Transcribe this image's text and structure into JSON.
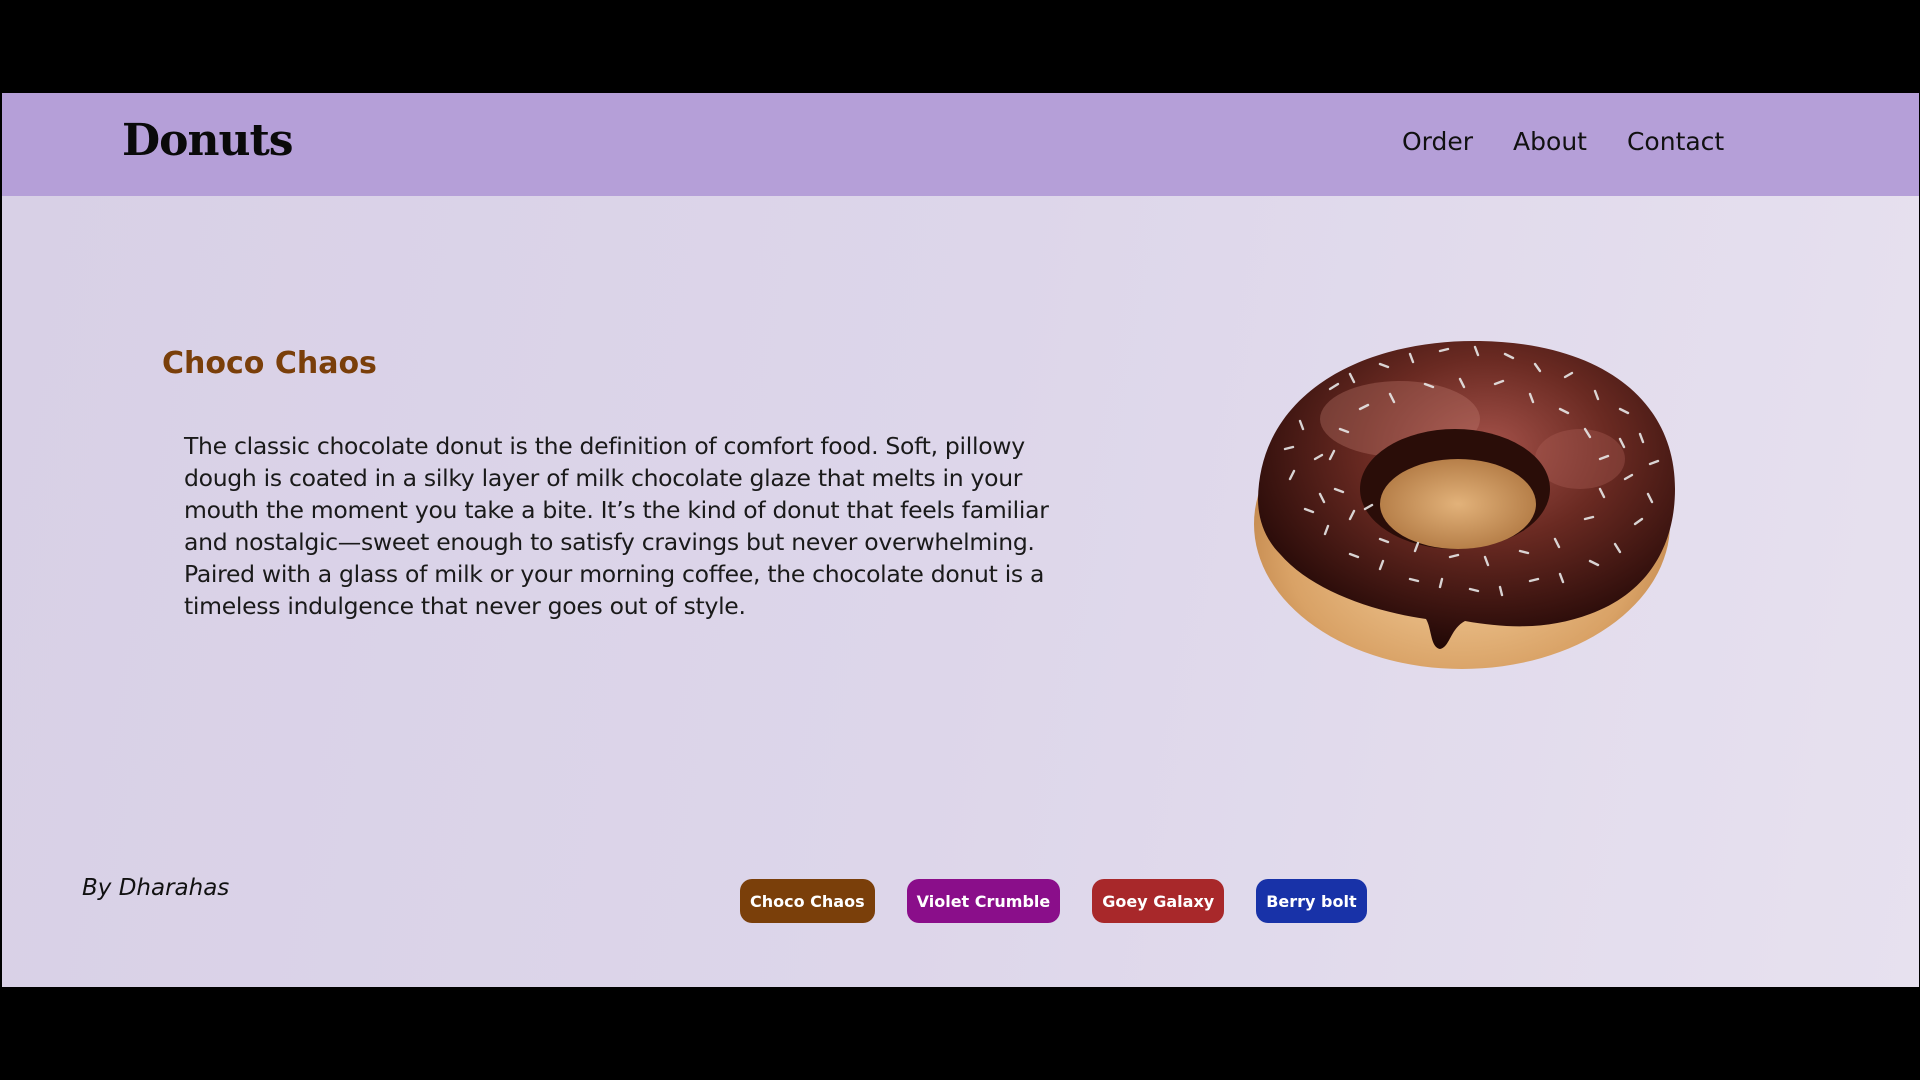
{
  "brand": {
    "logo": "Donuts"
  },
  "nav": {
    "items": [
      "Order",
      "About",
      "Contact"
    ]
  },
  "product": {
    "title": "Choco Chaos",
    "description": "The classic chocolate donut is the definition of comfort food. Soft, pillowy dough is coated in a silky layer of milk chocolate glaze that melts in your mouth the moment you take a bite. It’s the kind of donut that feels familiar and nostalgic—sweet enough to satisfy cravings but never overwhelming. Paired with a glass of milk or your morning coffee, the chocolate donut is a timeless indulgence that never goes out of style.",
    "image_icon": "chocolate-donut-image"
  },
  "footer": {
    "credit": "By Dharahas"
  },
  "flavors": [
    {
      "label": "Choco Chaos",
      "color": "#7a3f0a"
    },
    {
      "label": "Violet Crumble",
      "color": "#8a0e8a"
    },
    {
      "label": "Goey Galaxy",
      "color": "#a8282a"
    },
    {
      "label": "Berry bolt",
      "color": "#1832a8"
    }
  ],
  "colors": {
    "navbar": "#b59fd8",
    "title": "#7a3f0a",
    "background": "#ddd6ea"
  }
}
